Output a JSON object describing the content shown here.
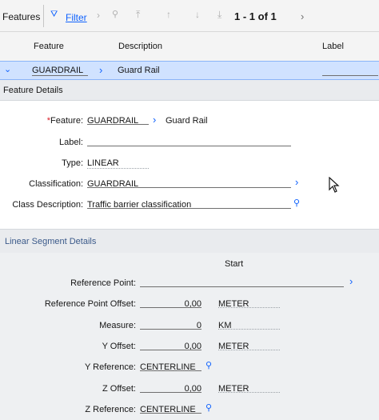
{
  "toolbar": {
    "title": "Features",
    "filter_label": "Filter",
    "pagination": "1 - 1 of 1"
  },
  "table": {
    "columns": [
      "Feature",
      "Description",
      "Label"
    ],
    "row": {
      "feature": "GUARDRAIL",
      "description": "Guard Rail",
      "label": ""
    }
  },
  "feature_details": {
    "heading": "Feature Details",
    "feature_label": "Feature:",
    "feature_value": "GUARDRAIL",
    "feature_desc": "Guard Rail",
    "label_label": "Label:",
    "label_value": "",
    "type_label": "Type:",
    "type_value": "LINEAR",
    "classification_label": "Classification:",
    "classification_value": "GUARDRAIL",
    "class_desc_label": "Class Description:",
    "class_desc_value": "Traffic barrier classification"
  },
  "linear": {
    "heading": "Linear Segment Details",
    "start_label": "Start",
    "reference_point_label": "Reference Point:",
    "reference_point_value": "",
    "ref_offset_label": "Reference Point Offset:",
    "ref_offset_value": "0,00",
    "ref_offset_unit": "METER",
    "measure_label": "Measure:",
    "measure_value": "0",
    "measure_unit": "KM",
    "y_offset_label": "Y Offset:",
    "y_offset_value": "0,00",
    "y_offset_unit": "METER",
    "y_reference_label": "Y Reference:",
    "y_reference_value": "CENTERLINE",
    "z_offset_label": "Z Offset:",
    "z_offset_value": "0,00",
    "z_offset_unit": "METER",
    "z_reference_label": "Z Reference:",
    "z_reference_value": "CENTERLINE"
  },
  "colors": {
    "accent": "#0f62fe",
    "selected_row": "#d0e2ff",
    "required": "#da1e28"
  }
}
